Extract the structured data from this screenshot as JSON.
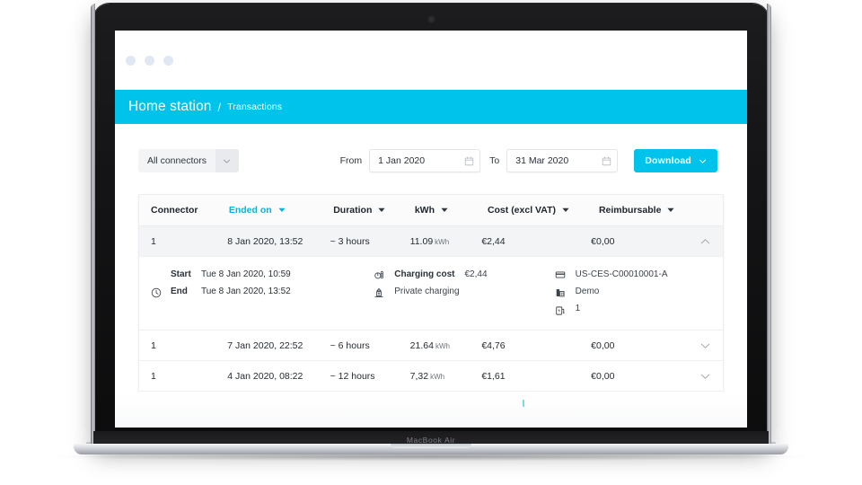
{
  "device": {
    "model_label": "MacBook Air"
  },
  "browser": {
    "dots": [
      "close-dot",
      "minimize-dot",
      "maximize-dot"
    ]
  },
  "header": {
    "title": "Home station",
    "separator": "/",
    "subtitle": "Transactions",
    "accent_color": "#00c3ec"
  },
  "filters": {
    "connector_select": {
      "value": "All connectors",
      "caret_icon": "chevron-down-icon"
    },
    "from": {
      "label": "From",
      "value": "1 Jan 2020",
      "placeholder": "1 Jan 2020",
      "icon": "calendar-icon"
    },
    "to": {
      "label": "To",
      "value": "31 Mar 2020",
      "placeholder": "31 Mar 2020",
      "icon": "calendar-icon"
    },
    "download": {
      "label": "Download",
      "caret_icon": "chevron-down-icon",
      "color": "#00c3ec"
    }
  },
  "table": {
    "columns": [
      {
        "label": "Connector",
        "sortable": false,
        "active": false,
        "sort_icon": ""
      },
      {
        "label": "Ended on",
        "sortable": true,
        "active": true,
        "sort_icon": "caret-down-icon"
      },
      {
        "label": "Duration",
        "sortable": true,
        "active": false,
        "sort_icon": "caret-down-icon"
      },
      {
        "label": "kWh",
        "sortable": true,
        "active": false,
        "sort_icon": "caret-down-icon"
      },
      {
        "label": "Cost (excl VAT)",
        "sortable": true,
        "active": false,
        "sort_icon": "caret-down-icon"
      },
      {
        "label": "Reimbursable",
        "sortable": true,
        "active": false,
        "sort_icon": "caret-down-icon"
      }
    ],
    "active_sort_color": "#00b6e0",
    "rows": [
      {
        "connector": "1",
        "ended_on": "8 Jan 2020, 13:52",
        "duration": "~ 3 hours",
        "kwh": "11.09",
        "kwh_unit": "kWh",
        "cost": "€2,44",
        "reimbursable": "€0,00",
        "expanded": true,
        "chevron_icon": "chevron-up-icon"
      },
      {
        "connector": "1",
        "ended_on": "7 Jan 2020, 22:52",
        "duration": "~ 6 hours",
        "kwh": "21.64",
        "kwh_unit": "kWh",
        "cost": "€4,76",
        "reimbursable": "€0,00",
        "expanded": false,
        "chevron_icon": "chevron-down-icon"
      },
      {
        "connector": "1",
        "ended_on": "4 Jan 2020, 08:22",
        "duration": "~ 12 hours",
        "kwh": "7,32",
        "kwh_unit": "kWh",
        "cost": "€1,61",
        "reimbursable": "€0,00",
        "expanded": false,
        "chevron_icon": "chevron-down-icon"
      }
    ],
    "detail": {
      "time_icon": "clock-icon",
      "start_label": "Start",
      "start_value": "Tue 8 Jan 2020, 10:59",
      "end_label": "End",
      "end_value": "Tue 8 Jan 2020, 13:52",
      "cost_icon": "charge-meter-icon",
      "cost_label": "Charging cost",
      "cost_value": "€2,44",
      "charging_type_icon": "charging-station-icon",
      "charging_type_label": "Private charging",
      "card_icon": "card-icon",
      "card_value": "US-CES-C00010001-A",
      "site_icon": "building-icon",
      "site_value": "Demo",
      "connector_icon": "charge-point-icon",
      "connector_value": "1"
    }
  }
}
